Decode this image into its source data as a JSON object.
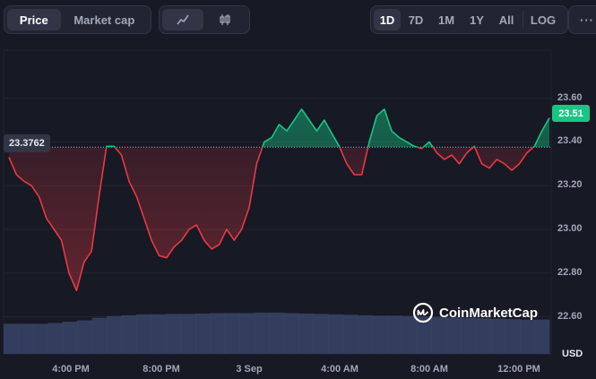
{
  "toolbar": {
    "price_tab": "Price",
    "market_cap_tab": "Market cap",
    "line_icon": "line-chart-icon",
    "candle_icon": "candlestick-icon",
    "ranges": [
      "1D",
      "7D",
      "1M",
      "1Y",
      "All"
    ],
    "active_range": "1D",
    "log_label": "LOG",
    "more_label": "···"
  },
  "colors": {
    "up": "#16c784",
    "down": "#ea3943",
    "volume": "#3d4970",
    "background": "#171924"
  },
  "labels": {
    "open_price": "23.3762",
    "current_price": "23.51",
    "currency": "USD",
    "brand": "CoinMarketCap",
    "brand_icon": "coinmarketcap-logo-icon"
  },
  "chart_data": {
    "type": "area",
    "x_ticks": [
      "4:00 PM",
      "8:00 PM",
      "3 Sep",
      "4:00 AM",
      "8:00 AM",
      "12:00 PM"
    ],
    "y_ticks": [
      "23.60",
      "23.40",
      "23.20",
      "23.00",
      "22.80",
      "22.60"
    ],
    "ylim": [
      22.43,
      23.82
    ],
    "baseline": 23.3762,
    "grid": true,
    "series": [
      {
        "values": [
          23.33,
          23.25,
          23.22,
          23.2,
          23.15,
          23.05,
          23.0,
          22.95,
          22.8,
          22.72,
          22.85,
          22.9,
          23.15,
          23.38,
          23.38,
          23.34,
          23.22,
          23.15,
          23.05,
          22.95,
          22.88,
          22.87,
          22.92,
          22.95,
          23.0,
          23.02,
          22.95,
          22.91,
          22.93,
          23.0,
          22.95,
          23.0,
          23.1,
          23.3,
          23.4,
          23.42,
          23.48,
          23.45,
          23.5,
          23.55,
          23.5,
          23.45,
          23.5,
          23.44,
          23.38,
          23.3,
          23.25,
          23.25,
          23.4,
          23.52,
          23.55,
          23.45,
          23.42,
          23.4,
          23.38,
          23.37,
          23.4,
          23.35,
          23.32,
          23.34,
          23.3,
          23.35,
          23.38,
          23.3,
          23.28,
          23.32,
          23.3,
          23.27,
          23.3,
          23.35,
          23.38,
          23.45,
          23.51
        ]
      }
    ],
    "volume": [
      0.7,
      0.7,
      0.7,
      0.72,
      0.75,
      0.78,
      0.84,
      0.88,
      0.9,
      0.92,
      0.92,
      0.93,
      0.93,
      0.94,
      0.95,
      0.95,
      0.95,
      0.96,
      0.96,
      0.95,
      0.94,
      0.93,
      0.92,
      0.91,
      0.9,
      0.89,
      0.89,
      0.88,
      0.87,
      0.86,
      0.85,
      0.84,
      0.83,
      0.82,
      0.81,
      0.8,
      0.8
    ]
  }
}
